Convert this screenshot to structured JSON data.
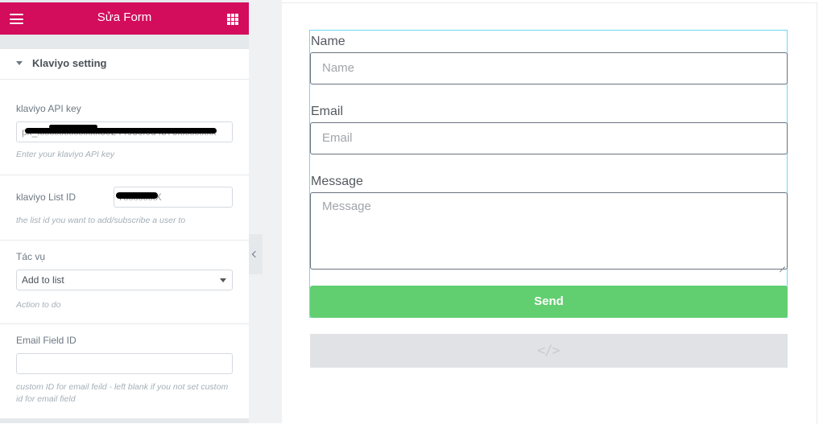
{
  "panel": {
    "title": "Sửa Form",
    "section_title": "Klaviyo setting"
  },
  "controls": {
    "api_key": {
      "label": "klaviyo API key",
      "value": "pk_xxxxxxxxxxxxx8e24403cf0d4b73xxxxxxxx",
      "description": "Enter your klaviyo API key"
    },
    "list_id": {
      "label": "klaviyo List ID",
      "value": "RxxxxxxX",
      "description": "the list id you want to add/subscribe a user to"
    },
    "action": {
      "label": "Tác vụ",
      "selected": "Add to list",
      "description": "Action to do"
    },
    "email_field": {
      "label": "Email Field ID",
      "value": "",
      "description": "custom ID for email feild - left blank if you not set custom id for email field"
    }
  },
  "form": {
    "name_label": "Name",
    "name_placeholder": "Name",
    "email_label": "Email",
    "email_placeholder": "Email",
    "message_label": "Message",
    "message_placeholder": "Message",
    "send_label": "Send",
    "code_icon": "</>"
  },
  "colors": {
    "header": "#d30c5c",
    "send_button": "#61ce70",
    "outline": "#71d7f7"
  },
  "icons": {
    "menu": "hamburger-icon",
    "apps": "grid-icon",
    "section": "caret-down-icon",
    "collapse": "chevron-left-icon",
    "code": "code-icon"
  }
}
